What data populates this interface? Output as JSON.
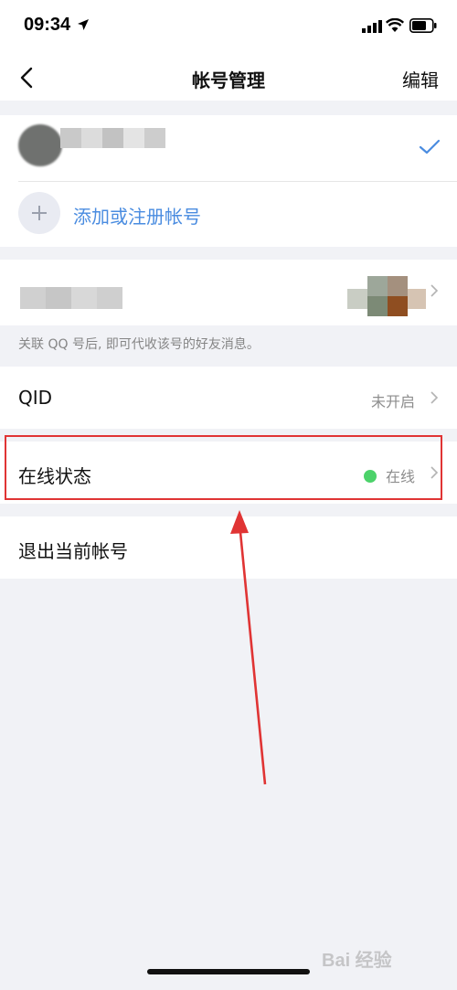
{
  "status_bar": {
    "time": "09:34"
  },
  "nav": {
    "title": "帐号管理",
    "edit_label": "编辑"
  },
  "accounts": {
    "add_label": "添加或注册帐号"
  },
  "linked": {
    "hint": "关联 QQ 号后, 即可代收该号的好友消息。"
  },
  "rows": {
    "qid": {
      "label": "QID",
      "value": "未开启"
    },
    "status": {
      "label": "在线状态",
      "value": "在线"
    },
    "logout": {
      "label": "退出当前帐号"
    }
  },
  "watermark": "Bai 经验",
  "colors": {
    "accent": "#4a8ce0",
    "online": "#4cd26a",
    "highlight": "#e03434",
    "background": "#f1f2f6"
  },
  "icons": [
    "location-arrow-icon",
    "signal-icon",
    "wifi-icon",
    "battery-icon",
    "back-chevron-icon",
    "checkmark-icon",
    "plus-icon",
    "chevron-right-icon"
  ]
}
